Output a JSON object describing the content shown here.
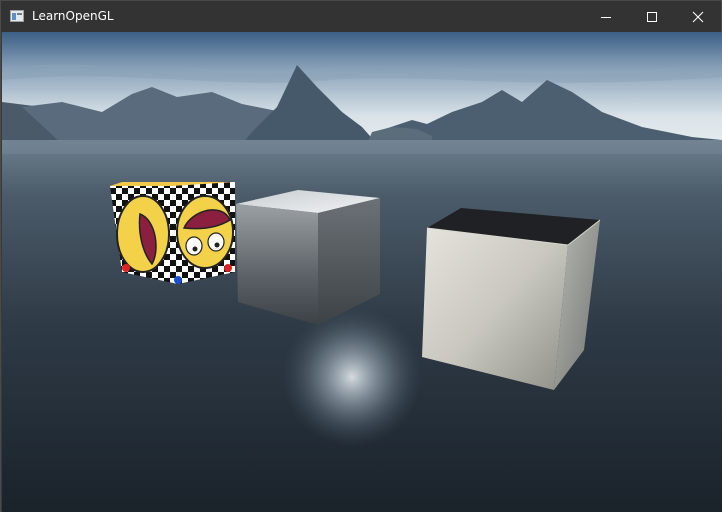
{
  "window": {
    "title": "LearnOpenGL",
    "controls": {
      "minimize_icon": "minimize-icon",
      "maximize_icon": "maximize-icon",
      "close_icon": "close-icon"
    }
  },
  "colors": {
    "titlebar": "#333333",
    "sky_top": "#3c5f86",
    "sky_horizon": "#dfe6ea",
    "water_near": "#1e2730",
    "water_far": "#5d6f7e",
    "mountains": "#455667",
    "face_yellow": "#f3d24a",
    "face_maroon": "#8a1f3f"
  },
  "scene": {
    "objects": [
      "textured-smiley-cube",
      "reflective-cube",
      "refractive-glass-cube"
    ]
  }
}
